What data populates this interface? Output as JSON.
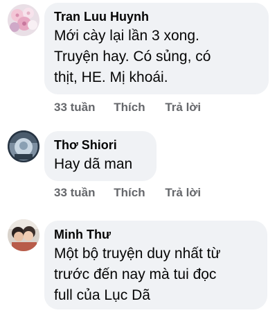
{
  "comments": [
    {
      "author": "Tran Luu Huynh",
      "lines": [
        "Mới cày lại lần 3 xong.",
        "Truyện hay. Có sủng, có",
        "thịt, HE. Mị khoái."
      ],
      "time": "33 tuần",
      "like_label": "Thích",
      "reply_label": "Trả lời"
    },
    {
      "author": "Thơ Shiori",
      "lines": [
        "Hay dã man"
      ],
      "time": "33 tuần",
      "like_label": "Thích",
      "reply_label": "Trả lời"
    },
    {
      "author": "Minh Thư",
      "lines": [
        "Một bộ truyện duy nhất từ",
        "trước đến nay mà tui đọc",
        "full của Lục Dã"
      ]
    }
  ]
}
